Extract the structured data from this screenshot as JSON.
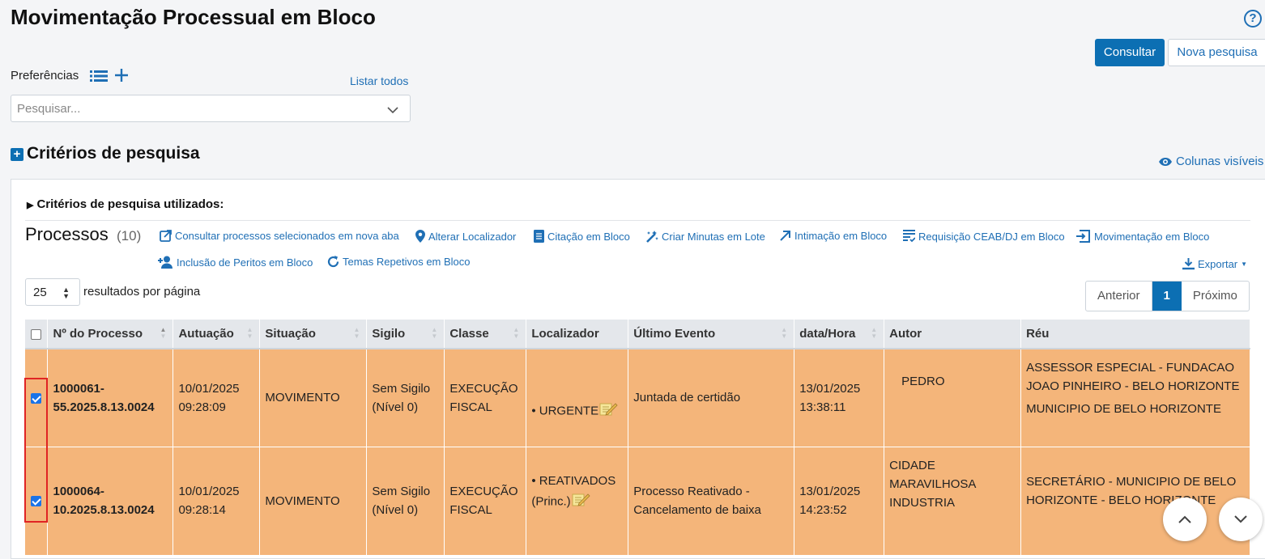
{
  "page": {
    "title": "Movimentação Processual em Bloco"
  },
  "header": {
    "consultar_label": "Consultar",
    "nova_pesquisa_label": "Nova pesquisa",
    "help_icon": "?"
  },
  "preferencias": {
    "label": "Preferências",
    "listar_todos": "Listar todos",
    "placeholder": "Pesquisar..."
  },
  "criterios": {
    "title": "Critérios de pesquisa",
    "colunas_visiveis": "Colunas visíveis",
    "utilizados": "Critérios de pesquisa utilizados:"
  },
  "processos": {
    "title": "Processos",
    "count": "(10)",
    "actions": [
      {
        "label": "Consultar processos selecionados em nova aba",
        "icon": "external-link-icon"
      },
      {
        "label": "Alterar Localizador",
        "icon": "map-pin-icon"
      },
      {
        "label": "Citação em Bloco",
        "icon": "document-icon"
      },
      {
        "label": "Criar Minutas em Lote",
        "icon": "magic-wand-icon"
      },
      {
        "label": "Intimação em Bloco",
        "icon": "arrow-up-right-icon"
      },
      {
        "label": "Requisição CEAB/DJ em Bloco",
        "icon": "list-check-icon"
      },
      {
        "label": "Movimentação em Bloco",
        "icon": "sign-in-icon"
      },
      {
        "label": "Inclusão de Peritos em Bloco",
        "icon": "user-add-icon"
      },
      {
        "label": "Temas Repetivos em Bloco",
        "icon": "refresh-icon"
      }
    ],
    "exportar": "Exportar",
    "per_page_value": "25",
    "per_page_label": "resultados por página",
    "pagination": {
      "prev": "Anterior",
      "current": "1",
      "next": "Próximo"
    }
  },
  "table": {
    "columns": [
      "Nº do Processo",
      "Autuação",
      "Situação",
      "Sigilo",
      "Classe",
      "Localizador",
      "Último Evento",
      "data/Hora",
      "Autor",
      "Réu"
    ],
    "rows": [
      {
        "checked": true,
        "numero": [
          "1000061-",
          "55.2025.8.13.0024"
        ],
        "autuacao": [
          "10/01/2025",
          "09:28:09"
        ],
        "situacao": "MOVIMENTO",
        "sigilo": [
          "Sem Sigilo",
          "(Nível 0)"
        ],
        "classe": [
          "EXECUÇÃO",
          "FISCAL"
        ],
        "localizador": [
          "• URGENTE"
        ],
        "ultimo_evento": [
          "Juntada de certidão"
        ],
        "data_hora": [
          "13/01/2025",
          "13:38:11"
        ],
        "autor": [
          "PEDRO"
        ],
        "reu": [
          "ASSESSOR ESPECIAL - FUNDACAO JOAO PINHEIRO - BELO HORIZONTE",
          "MUNICIPIO DE BELO HORIZONTE"
        ]
      },
      {
        "checked": true,
        "numero": [
          "1000064-",
          "10.2025.8.13.0024"
        ],
        "autuacao": [
          "10/01/2025",
          "09:28:14"
        ],
        "situacao": "MOVIMENTO",
        "sigilo": [
          "Sem Sigilo",
          "(Nível 0)"
        ],
        "classe": [
          "EXECUÇÃO",
          "FISCAL"
        ],
        "localizador": [
          "• REATIVADOS",
          "(Princ.)"
        ],
        "ultimo_evento": [
          "Processo Reativado -",
          "Cancelamento de baixa"
        ],
        "data_hora": [
          "13/01/2025",
          "14:23:52"
        ],
        "autor": [
          "CIDADE",
          "MARAVILHOSA",
          "INDUSTRIA"
        ],
        "reu": [
          "SECRETÁRIO - MUNICIPIO DE BELO HORIZONTE - BELO HORIZONTE"
        ]
      }
    ]
  },
  "colors": {
    "primary": "#0c6fb3",
    "link": "#1f6fb5",
    "row_highlight": "#f4b57a",
    "header_bg": "#e4e7eb",
    "selection_box": "#e02424"
  }
}
